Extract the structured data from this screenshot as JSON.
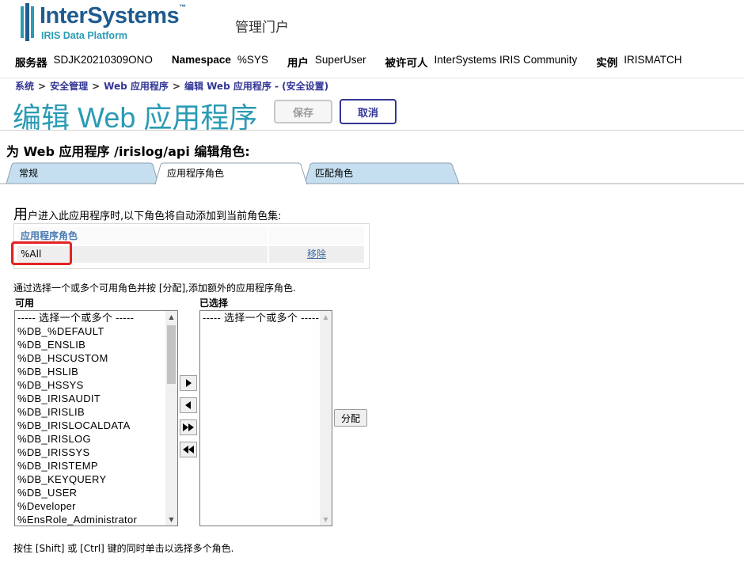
{
  "header": {
    "logo_name": "InterSystems",
    "logo_tm": "™",
    "logo_sub": "IRIS Data Platform",
    "portal_title": "管理门户"
  },
  "infobar": {
    "server_label": "服务器",
    "server_value": "SDJK20210309ONO",
    "namespace_label": "Namespace",
    "namespace_value": "%SYS",
    "user_label": "用户",
    "user_value": "SuperUser",
    "licensee_label": "被许可人",
    "licensee_value": "InterSystems IRIS Community",
    "instance_label": "实例",
    "instance_value": "IRISMATCH"
  },
  "breadcrumb": {
    "items": [
      "系统",
      "安全管理",
      "Web 应用程序",
      "编辑 Web 应用程序"
    ],
    "separator": ">",
    "suffix": " - (安全设置)"
  },
  "page_title": "编辑 Web 应用程序",
  "toolbar": {
    "save_label": "保存",
    "cancel_label": "取消"
  },
  "subheading": "为 Web 应用程序 /irislog/api 编辑角色:",
  "tabs": [
    {
      "label": "常规",
      "active": false
    },
    {
      "label": "应用程序角色",
      "active": true
    },
    {
      "label": "匹配角色",
      "active": false
    }
  ],
  "intro": {
    "first_char": "用",
    "rest": "户进入此应用程序时,以下角色将自动添加到当前角色集:"
  },
  "roles_table": {
    "header": "应用程序角色",
    "rows": [
      {
        "role": "%All",
        "action": "移除"
      }
    ]
  },
  "assign_hint": "通过选择一个或多个可用角色并按 [分配],添加额外的应用程序角色.",
  "available": {
    "label": "可用",
    "items": [
      "----- 选择一个或多个 -----",
      "%DB_%DEFAULT",
      "%DB_ENSLIB",
      "%DB_HSCUSTOM",
      "%DB_HSLIB",
      "%DB_HSSYS",
      "%DB_IRISAUDIT",
      "%DB_IRISLIB",
      "%DB_IRISLOCALDATA",
      "%DB_IRISLOG",
      "%DB_IRISSYS",
      "%DB_IRISTEMP",
      "%DB_KEYQUERY",
      "%DB_USER",
      "%Developer",
      "%EnsRole_Administrator"
    ]
  },
  "selected": {
    "label": "已选择",
    "items": [
      "----- 选择一个或多个 -----"
    ]
  },
  "assign_button": "分配",
  "footer_hint": "按住 [Shift] 或 [Ctrl] 键的同时单击以选择多个角色.",
  "colors": {
    "brand": "#1f5b8f",
    "accent": "#2a9bb4",
    "link": "#333695",
    "highlight": "#e52323",
    "tab_inactive": "#c5dff0"
  },
  "icons": [
    "move-right-icon",
    "move-left-icon",
    "move-all-right-icon",
    "move-all-left-icon",
    "scroll-up-icon",
    "scroll-down-icon"
  ]
}
